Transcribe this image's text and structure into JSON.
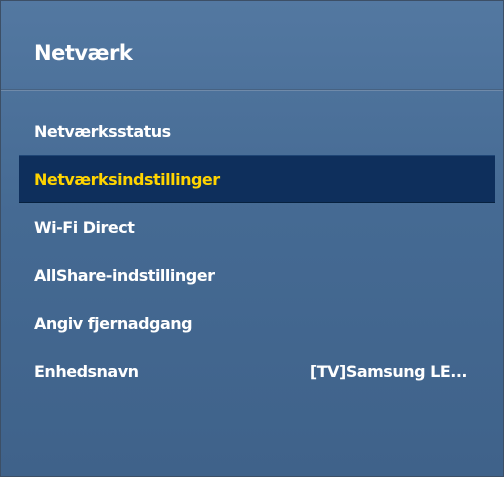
{
  "menu": {
    "title": "Netværk",
    "items": [
      {
        "label": "Netværksstatus",
        "value": "",
        "selected": false
      },
      {
        "label": "Netværksindstillinger",
        "value": "",
        "selected": true
      },
      {
        "label": "Wi-Fi Direct",
        "value": "",
        "selected": false
      },
      {
        "label": "AllShare-indstillinger",
        "value": "",
        "selected": false
      },
      {
        "label": "Angiv fjernadgang",
        "value": "",
        "selected": false
      },
      {
        "label": "Enhedsnavn",
        "value": "[TV]Samsung LE...",
        "selected": false
      }
    ]
  },
  "colors": {
    "background": "#4a6f98",
    "selected_background": "#0e2f5c",
    "selected_text": "#ffd400",
    "text": "#ffffff"
  }
}
